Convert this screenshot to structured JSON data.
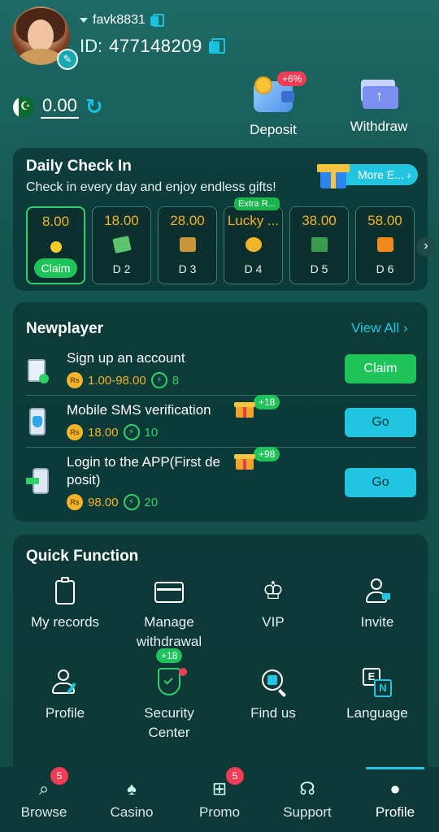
{
  "user": {
    "username": "favk8831",
    "id_label": "ID:",
    "id_value": "477148209",
    "balance": "0.00"
  },
  "actions": {
    "deposit_label": "Deposit",
    "deposit_bonus": "+6%",
    "withdraw_label": "Withdraw"
  },
  "daily_checkin": {
    "title": "Daily Check In",
    "subtitle": "Check in every day and enjoy endless gifts!",
    "more_label": "More E...",
    "days": [
      {
        "amount": "8.00",
        "label": "Claim",
        "state": "claimable"
      },
      {
        "amount": "18.00",
        "label": "D 2"
      },
      {
        "amount": "28.00",
        "label": "D 3"
      },
      {
        "amount": "Lucky ...",
        "label": "D 4",
        "tag": "Extra R..."
      },
      {
        "amount": "38.00",
        "label": "D 5"
      },
      {
        "amount": "58.00",
        "label": "D 6"
      }
    ]
  },
  "newplayer": {
    "title": "Newplayer",
    "view_all": "View All",
    "tasks": [
      {
        "title": "Sign up an account",
        "reward": "1.00-98.00",
        "points": "8",
        "button": "Claim"
      },
      {
        "title": "Mobile SMS verification",
        "reward": "18.00",
        "points": "10",
        "button": "Go",
        "bonus": "+18"
      },
      {
        "title": "Login to the APP(First de posit)",
        "title_line1": "Login to the APP(First de",
        "title_line2": "posit)",
        "reward": "98.00",
        "points": "20",
        "button": "Go",
        "bonus": "+98"
      }
    ],
    "currency_symbol": "Rs"
  },
  "quick_function": {
    "title": "Quick Function",
    "items": [
      {
        "label": "My records",
        "icon": "clipboard-icon"
      },
      {
        "label": "Manage withdrawal",
        "icon": "card-icon"
      },
      {
        "label": "VIP",
        "icon": "crown-icon"
      },
      {
        "label": "Invite",
        "icon": "invite-user-icon"
      },
      {
        "label": "Profile",
        "icon": "profile-edit-icon"
      },
      {
        "label": "Security Center",
        "icon": "shield-check-icon",
        "bonus": "+18"
      },
      {
        "label": "Find us",
        "icon": "search-doc-icon"
      },
      {
        "label": "Language",
        "icon": "language-icon"
      }
    ]
  },
  "bottom_nav": {
    "items": [
      {
        "label": "Browse",
        "badge": "5"
      },
      {
        "label": "Casino"
      },
      {
        "label": "Promo",
        "badge": "5"
      },
      {
        "label": "Support"
      },
      {
        "label": "Profile",
        "active": true
      }
    ]
  },
  "colors": {
    "accent": "#22c5e0",
    "green": "#1ec35a",
    "gold": "#f1b42a",
    "red": "#f23b55"
  }
}
